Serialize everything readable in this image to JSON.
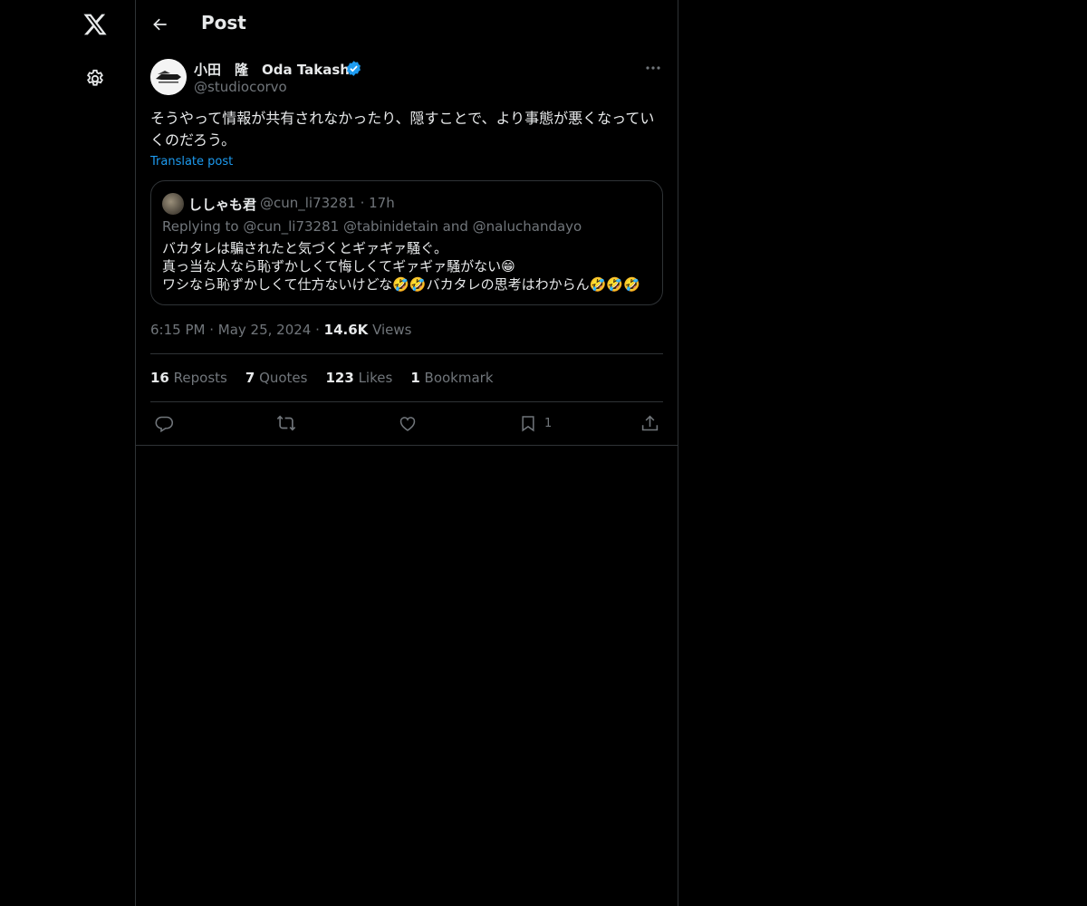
{
  "header": {
    "title": "Post"
  },
  "post": {
    "author_name": "小田　隆　Oda Takashi",
    "author_handle": "@studiocorvo",
    "text": "そうやって情報が共有されなかったり、隠すことで、より事態が悪くなっていくのだろう。",
    "translate_label": "Translate post",
    "time": "6:15 PM",
    "date": "May 25, 2024",
    "views_count": "14.6K",
    "views_label": "Views"
  },
  "quote": {
    "name": "ししゃも君",
    "handle": "@cun_li73281",
    "age": "17h",
    "reply_prefix": "Replying to",
    "reply_targets": "@cun_li73281 @tabinidetain and @naluchandayo",
    "lines": [
      "バカタレは騙されたと気づくとギァギァ騒ぐ。",
      "真っ当な人なら恥ずかしくて悔しくてギァギァ騒がない😁",
      "ワシなら恥ずかしくて仕方ないけどな🤣🤣バカタレの思考はわからん🤣🤣🤣"
    ]
  },
  "stats": {
    "reposts_count": "16",
    "reposts_label": "Reposts",
    "quotes_count": "7",
    "quotes_label": "Quotes",
    "likes_count": "123",
    "likes_label": "Likes",
    "bookmarks_count": "1",
    "bookmarks_label": "Bookmark"
  },
  "actions": {
    "bookmark_count": "1"
  },
  "colors": {
    "background": "#000000",
    "accent": "#1d9bf0",
    "muted": "#71767b",
    "border": "#2f3336"
  },
  "icons": [
    "x-logo-icon",
    "settings-gear-icon",
    "back-arrow-icon",
    "verified-badge-icon",
    "more-icon",
    "reply-icon",
    "repost-icon",
    "like-icon",
    "bookmark-icon",
    "share-icon"
  ]
}
